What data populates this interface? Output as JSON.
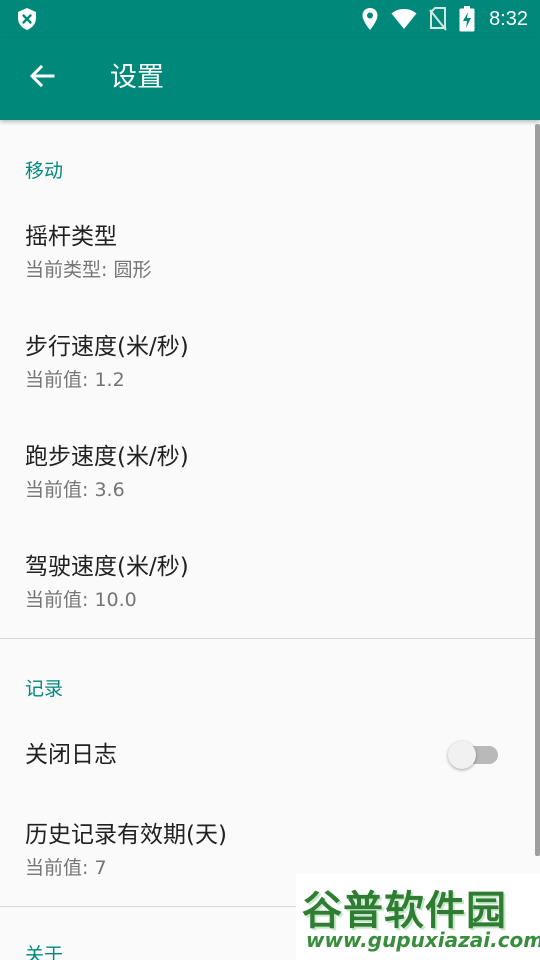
{
  "status_bar": {
    "time": "8:32",
    "left_icon": "shield-x-icon",
    "right_icons": [
      "location-icon",
      "wifi-icon",
      "no-sim-icon",
      "battery-charging-icon"
    ]
  },
  "app_bar": {
    "back_icon": "arrow-back-icon",
    "title": "设置",
    "color": "#00897b"
  },
  "sections": {
    "move": {
      "header": "移动",
      "joystick": {
        "title": "摇杆类型",
        "summary": "当前类型: 圆形"
      },
      "walk": {
        "title": "步行速度(米/秒)",
        "summary": "当前值: 1.2"
      },
      "run": {
        "title": "跑步速度(米/秒)",
        "summary": "当前值: 3.6"
      },
      "drive": {
        "title": "驾驶速度(米/秒)",
        "summary": "当前值: 10.0"
      }
    },
    "record": {
      "header": "记录",
      "close_log": {
        "title": "关闭日志",
        "switch_on": false
      },
      "history": {
        "title": "历史记录有效期(天)",
        "summary": "当前值: 7"
      }
    },
    "about": {
      "header": "关于"
    }
  },
  "watermark": {
    "text": "谷普软件园",
    "url": "www.gupuxiazai.com"
  },
  "colors": {
    "accent": "#00897b",
    "background": "#fafafa",
    "title_text": "#212121",
    "summary_text": "#757575"
  }
}
